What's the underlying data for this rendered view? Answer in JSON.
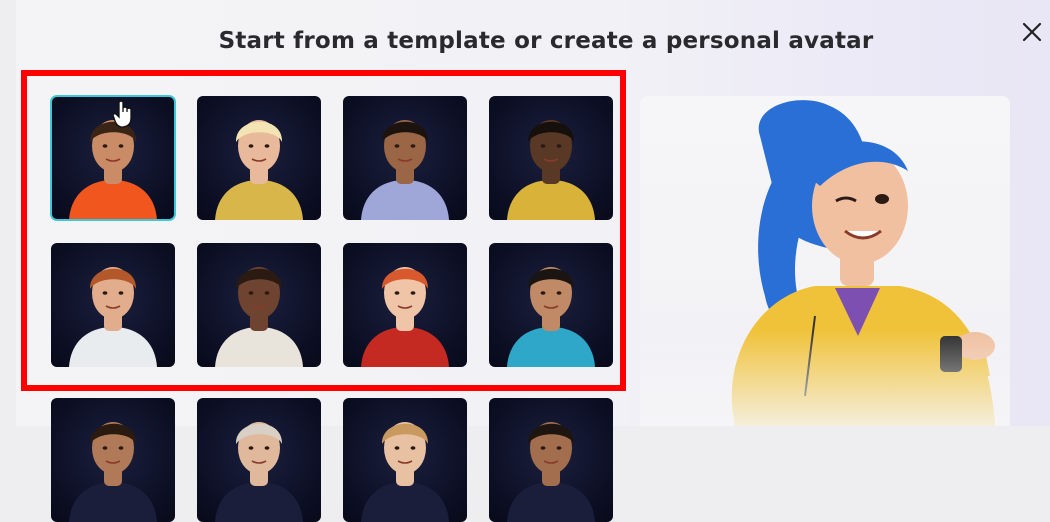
{
  "modal": {
    "title": "Start from a template or create a personal avatar",
    "close_icon": "close-icon"
  },
  "templates": [
    {
      "name": "avatar-template-1",
      "shirt": "#f0561e",
      "hair": "#3a2416",
      "skin": "#c98c66",
      "selected": true
    },
    {
      "name": "avatar-template-2",
      "shirt": "#d8b64a",
      "hair": "#f4e4b4",
      "skin": "#e8b99a",
      "selected": false
    },
    {
      "name": "avatar-template-3",
      "shirt": "#9fa6d8",
      "hair": "#1c130e",
      "skin": "#9a6646",
      "selected": false
    },
    {
      "name": "avatar-template-4",
      "shirt": "#d9b23a",
      "hair": "#16100c",
      "skin": "#5a3826",
      "selected": false
    },
    {
      "name": "avatar-template-5",
      "shirt": "#e9ecef",
      "hair": "#b2582a",
      "skin": "#e2ad8c",
      "selected": false
    },
    {
      "name": "avatar-template-6",
      "shirt": "#e8e4dc",
      "hair": "#2a1a12",
      "skin": "#6e4430",
      "selected": false
    },
    {
      "name": "avatar-template-7",
      "shirt": "#c42a22",
      "hair": "#d9592e",
      "skin": "#f0c4a6",
      "selected": false
    },
    {
      "name": "avatar-template-8",
      "shirt": "#2ea7c8",
      "hair": "#1a1412",
      "skin": "#c08a66",
      "selected": false
    },
    {
      "name": "avatar-template-9",
      "shirt": "#1a1e3a",
      "hair": "#2a1a10",
      "skin": "#b07a58",
      "selected": false
    },
    {
      "name": "avatar-template-10",
      "shirt": "#1a1e3a",
      "hair": "#d8d0c4",
      "skin": "#e0b89c",
      "selected": false
    },
    {
      "name": "avatar-template-11",
      "shirt": "#1a1e3a",
      "hair": "#c89a60",
      "skin": "#e8c0a2",
      "selected": false
    },
    {
      "name": "avatar-template-12",
      "shirt": "#1a1e3a",
      "hair": "#1e1410",
      "skin": "#a26e4e",
      "selected": false
    }
  ],
  "preview": {
    "hair": "#2a6fd6",
    "jacket": "#f0c23a",
    "skin": "#f0c0a0"
  },
  "colors": {
    "highlight": "#ff0000",
    "selected_outline": "#3cc8d8"
  }
}
